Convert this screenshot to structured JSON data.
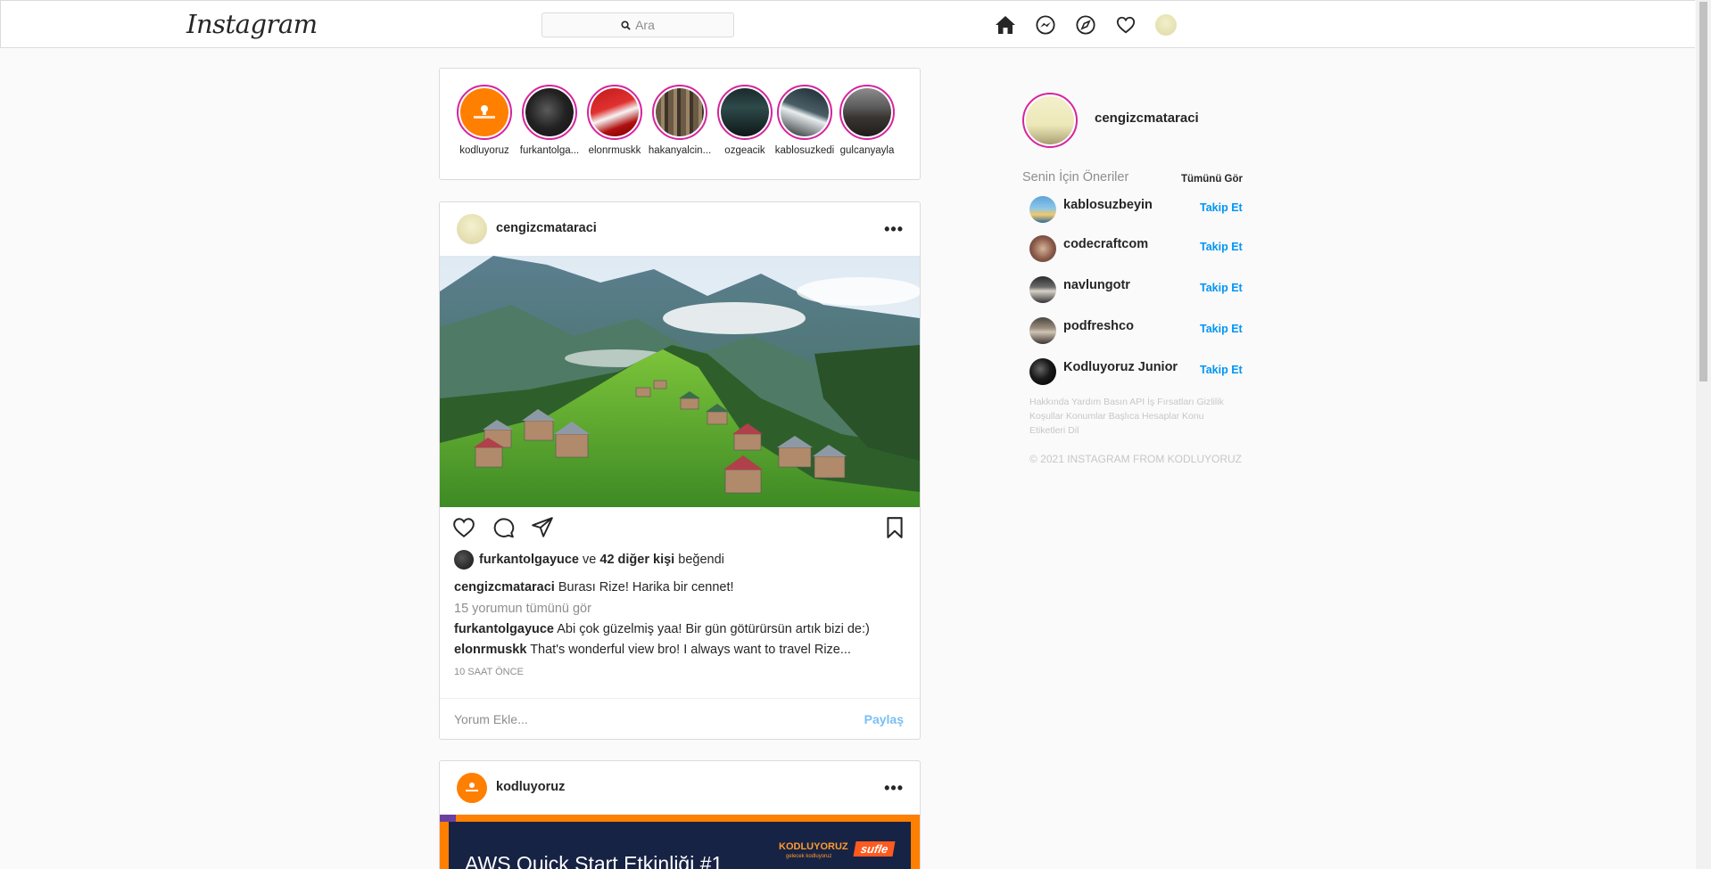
{
  "nav": {
    "logo": "Instagram",
    "search_placeholder": "Ara"
  },
  "stories": [
    {
      "name": "kodluyoruz"
    },
    {
      "name": "furkantolga..."
    },
    {
      "name": "elonrmuskk"
    },
    {
      "name": "hakanyalcin..."
    },
    {
      "name": "ozgeacik"
    },
    {
      "name": "kablosuzkedi"
    },
    {
      "name": "gulcanyayla"
    }
  ],
  "post1": {
    "username": "cengizcmataraci",
    "more": "•••",
    "liker": "furkantolgayuce",
    "likes_connector": "ve",
    "likes_count": "42 diğer kişi",
    "likes_suffix": "beğendi",
    "caption_user": "cengizcmataraci",
    "caption_text": "Burası Rize! Harika bir cennet!",
    "view_comments": "15 yorumun tümünü gör",
    "comments": [
      {
        "user": "furkantolgayuce",
        "text": "Abi çok güzelmiş yaa! Bir gün götürürsün artık bizi de:)"
      },
      {
        "user": "elonrmuskk",
        "text": "That's wonderful view bro! I always want to travel Rize..."
      }
    ],
    "time": "10 SAAT ÖNCE",
    "comment_placeholder": "Yorum Ekle...",
    "share_label": "Paylaş"
  },
  "post2": {
    "username": "kodluyoruz",
    "more": "•••",
    "banner_title": "AWS Quick Start Etkinliği #1",
    "banner_brand": "KODLUYORUZ",
    "banner_sub": "gelecek kodluyoruz",
    "banner_partner": "sufle"
  },
  "sidebar": {
    "me": "cengizcmataraci",
    "suggestions_title": "Senin İçin Öneriler",
    "see_all": "Tümünü Gör",
    "suggestions": [
      {
        "name": "kablosuzbeyin",
        "action": "Takip Et"
      },
      {
        "name": "codecraftcom",
        "action": "Takip Et"
      },
      {
        "name": "navlungotr",
        "action": "Takip Et"
      },
      {
        "name": "podfreshco",
        "action": "Takip Et"
      },
      {
        "name": "Kodluyoruz Junior",
        "action": "Takip Et"
      }
    ],
    "footer_links": "Hakkında Yardım Basın API İş Fırsatları Gizlilik Koşullar Konumlar Başlıca Hesaplar Konu Etiketleri Dil",
    "copyright": "© 2021 INSTAGRAM FROM KODLUYORUZ"
  },
  "colors": {
    "story_ring": "#d6249f",
    "link_blue": "#0095f6",
    "share_blue": "#79bff5",
    "kodluyoruz_orange": "#ff7f00"
  }
}
